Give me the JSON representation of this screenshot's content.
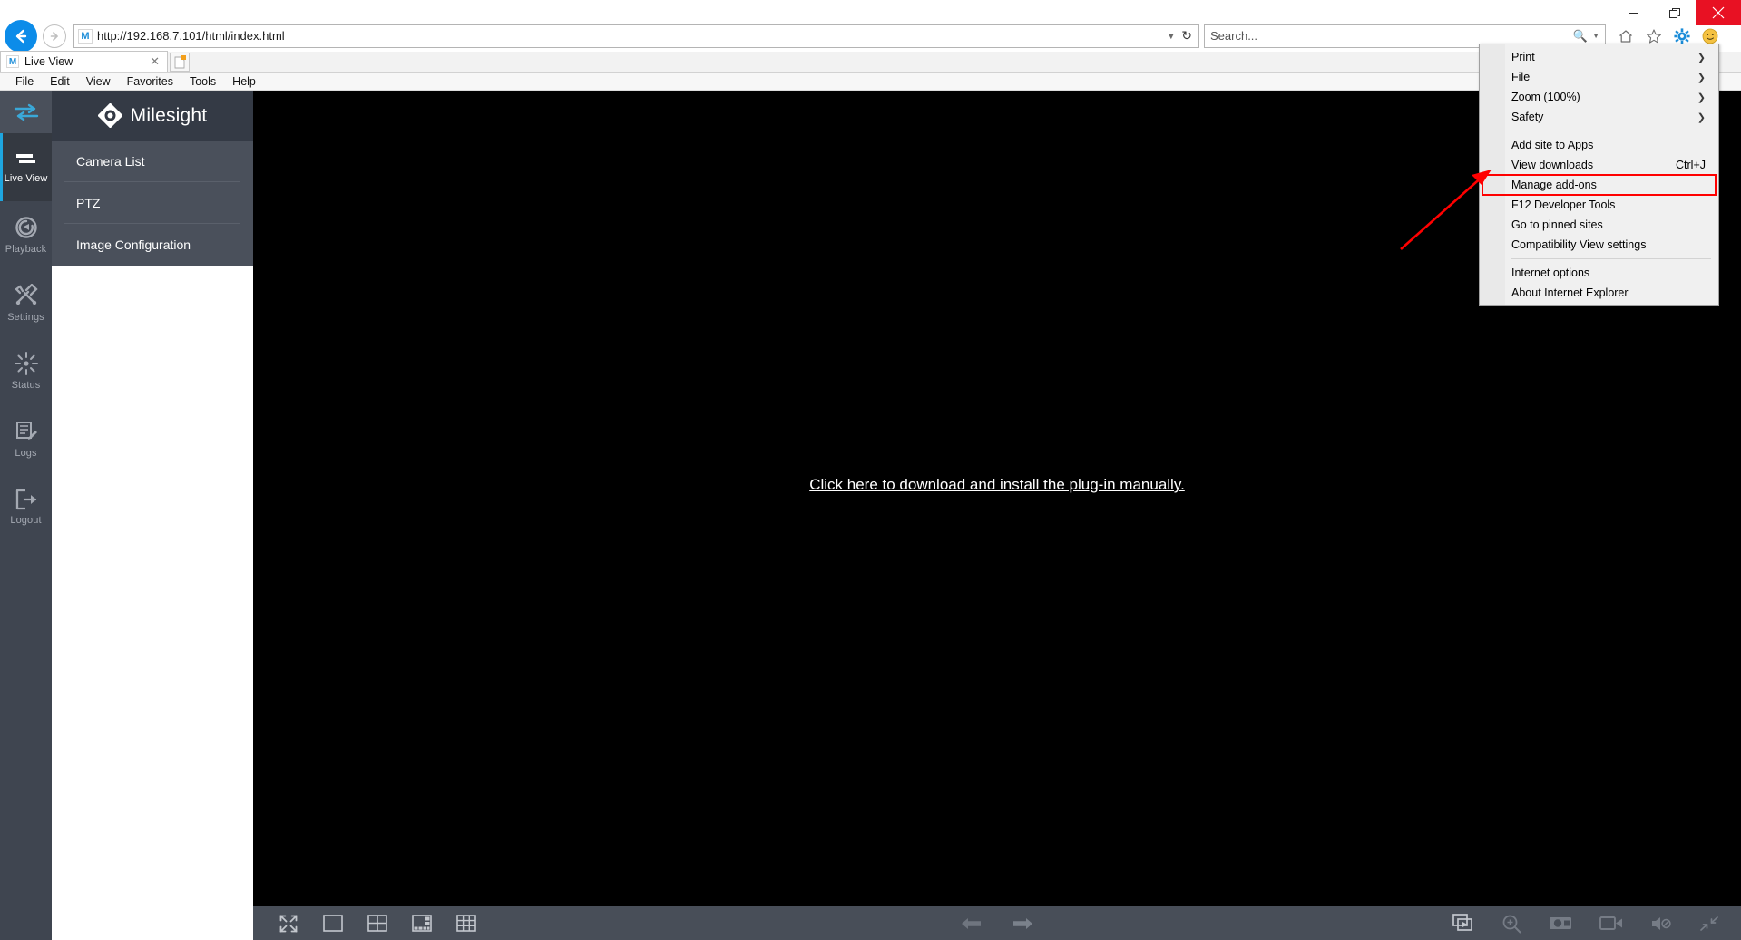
{
  "browser": {
    "window_controls": {
      "minimize": "minimize-icon",
      "restore": "restore-icon",
      "close": "close-icon"
    },
    "back_icon": "back-arrow-icon",
    "forward_icon": "forward-arrow-icon",
    "site_favicon_letter": "M",
    "address": {
      "url": "http://192.168.7.101/html/index.html",
      "dropdown_icon": "chevron-down-icon",
      "refresh_icon": "refresh-icon"
    },
    "search": {
      "placeholder": "Search...",
      "icon": "search-magnifier-icon",
      "dropdown_icon": "chevron-down-icon"
    },
    "toolbar_icons": [
      "home-icon",
      "favorites-star-icon",
      "tools-gear-icon",
      "smiley-feedback-icon"
    ],
    "tab": {
      "title": "Live View",
      "favicon_letter": "M",
      "close_icon": "close-icon"
    },
    "new_tab_label": "new-tab-button",
    "menubar": [
      "File",
      "Edit",
      "View",
      "Favorites",
      "Tools",
      "Help"
    ]
  },
  "ie_menu": {
    "groups": [
      [
        {
          "label": "Print",
          "submenu": true,
          "shortcut": ""
        },
        {
          "label": "File",
          "submenu": true,
          "shortcut": ""
        },
        {
          "label": "Zoom (100%)",
          "submenu": true,
          "shortcut": ""
        },
        {
          "label": "Safety",
          "submenu": true,
          "shortcut": ""
        }
      ],
      [
        {
          "label": "Add site to Apps",
          "submenu": false,
          "shortcut": ""
        },
        {
          "label": "View downloads",
          "submenu": false,
          "shortcut": "Ctrl+J"
        },
        {
          "label": "Manage add-ons",
          "submenu": false,
          "shortcut": "",
          "highlighted": true
        },
        {
          "label": "F12 Developer Tools",
          "submenu": false,
          "shortcut": ""
        },
        {
          "label": "Go to pinned sites",
          "submenu": false,
          "shortcut": ""
        },
        {
          "label": "Compatibility View settings",
          "submenu": false,
          "shortcut": ""
        }
      ],
      [
        {
          "label": "Internet options",
          "submenu": false,
          "shortcut": ""
        },
        {
          "label": "About Internet Explorer",
          "submenu": false,
          "shortcut": ""
        }
      ]
    ],
    "highlight_color": "#ff0000",
    "annotation_arrow_color": "#ff0000"
  },
  "app": {
    "brand": {
      "name": "Milesight",
      "logo_icon": "milesight-diamond-logo-icon"
    },
    "rail": {
      "toggle_icon": "collapse-expand-icon",
      "items": [
        {
          "label": "Live View",
          "icon": "live-view-icon",
          "active": true
        },
        {
          "label": "Playback",
          "icon": "playback-icon",
          "active": false
        },
        {
          "label": "Settings",
          "icon": "settings-tools-icon",
          "active": false
        },
        {
          "label": "Status",
          "icon": "status-burst-icon",
          "active": false
        },
        {
          "label": "Logs",
          "icon": "logs-document-icon",
          "active": false
        },
        {
          "label": "Logout",
          "icon": "logout-exit-icon",
          "active": false
        }
      ],
      "active_accent": "#1ea6e0"
    },
    "side_nav": [
      {
        "label": "Camera List"
      },
      {
        "label": "PTZ"
      },
      {
        "label": "Image Configuration"
      }
    ],
    "video": {
      "plugin_message": "Click here to download and install the plug-in manually."
    },
    "bottom_toolbar": {
      "left": [
        {
          "icon": "fullscreen-expand-icon"
        },
        {
          "icon": "layout-1x1-icon"
        },
        {
          "icon": "layout-2x2-icon"
        },
        {
          "icon": "layout-1plus5-icon"
        },
        {
          "icon": "layout-3x3-icon"
        }
      ],
      "center": [
        {
          "icon": "previous-page-arrow-icon"
        },
        {
          "icon": "next-page-arrow-icon"
        }
      ],
      "right": [
        {
          "icon": "stream-play-icon"
        },
        {
          "icon": "digital-zoom-icon"
        },
        {
          "icon": "snapshot-camera-icon"
        },
        {
          "icon": "record-video-icon"
        },
        {
          "icon": "audio-muted-icon"
        },
        {
          "icon": "exit-fullscreen-icon"
        }
      ]
    }
  }
}
